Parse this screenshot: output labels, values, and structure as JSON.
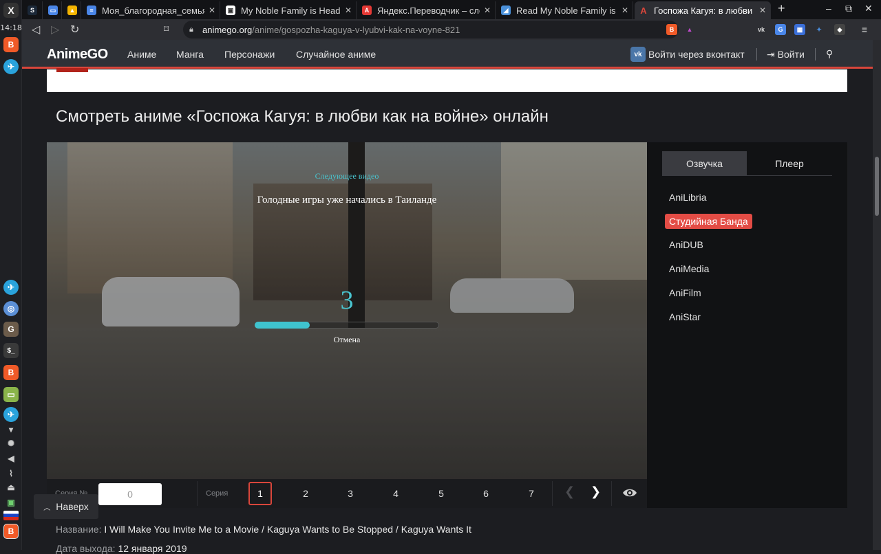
{
  "system": {
    "clock": "14:18"
  },
  "browser": {
    "tabs": [
      {
        "title": "Моя_благородная_семья",
        "favicon": "docs-icon",
        "color": "#4a86e8"
      },
      {
        "title": "My Noble Family is Heade",
        "favicon": "page-icon",
        "color": "#ffffff"
      },
      {
        "title": "Яндекс.Переводчик – сло",
        "favicon": "yandex-translate-icon",
        "color": "#e53935"
      },
      {
        "title": "Read My Noble Family is",
        "favicon": "reader-icon",
        "color": "#4a90d9"
      },
      {
        "title": "Госпожа Кагуя: в любви",
        "favicon": "animego-icon",
        "color": "#d9463b"
      }
    ],
    "url_host": "animego.org",
    "url_path": "/anime/gospozha-kaguya-v-lyubvi-kak-na-voyne-821"
  },
  "site": {
    "logo": "AnimeGO",
    "nav": [
      "Аниме",
      "Манга",
      "Персонажи",
      "Случайное аниме"
    ],
    "vk_login": "Войти через вконтакт",
    "login": "Войти",
    "accent": "#d9463b"
  },
  "page": {
    "title": "Смотреть аниме «Госпожа Кагуя: в любви как на войне» онлайн"
  },
  "player": {
    "next_label": "Следующее видео",
    "next_title": "Голодные игры уже начались в Таиланде",
    "countdown": "3",
    "progress": 0.3,
    "cancel": "Отмена",
    "episode_number_label": "Серия №",
    "episode_number_value": "0",
    "series_label": "Серия",
    "episodes": [
      "1",
      "2",
      "3",
      "4",
      "5",
      "6",
      "7"
    ],
    "active_episode": "1",
    "accent": "#3fc3ce"
  },
  "side_panel": {
    "tabs": [
      "Озвучка",
      "Плеер"
    ],
    "dubs": [
      "AniLibria",
      "Студийная Банда",
      "AniDUB",
      "AniMedia",
      "AniFilm",
      "AniStar"
    ],
    "active_dub": "Студийная Банда"
  },
  "info": {
    "back_to_top": "Наверх",
    "name_label": "Название:",
    "name_value": "I Will Make You Invite Me to a Movie / Kaguya Wants to Be Stopped / Kaguya Wants It",
    "date_label": "Дата выхода:",
    "date_value": "12 января 2019"
  }
}
